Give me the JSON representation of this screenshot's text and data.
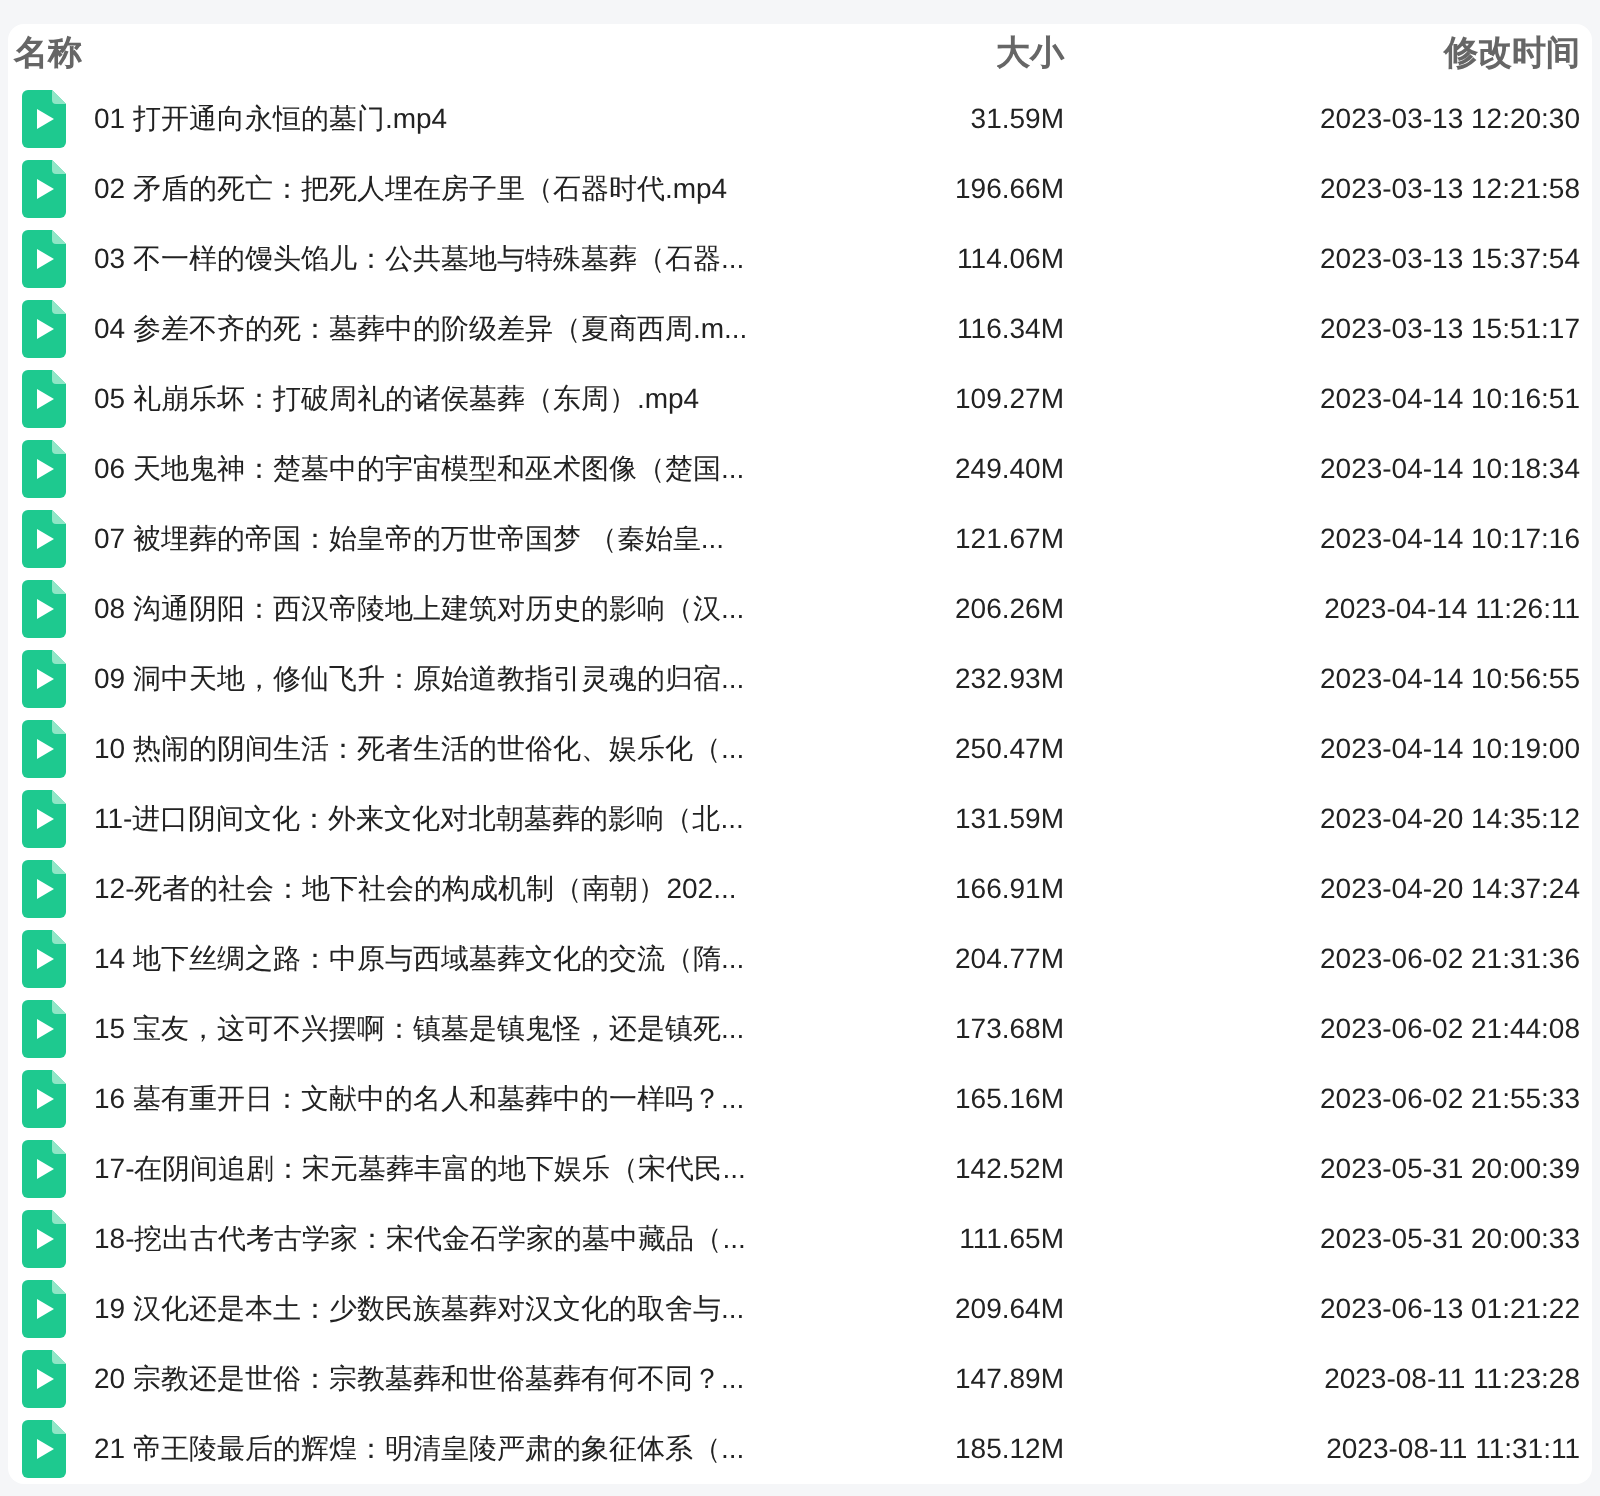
{
  "columns": [
    {
      "label": "名称"
    },
    {
      "label": "大小"
    },
    {
      "label": "修改时间"
    }
  ],
  "files": [
    {
      "name": "01 打开通向永恒的墓门.mp4",
      "size": "31.59M",
      "modified": "2023-03-13 12:20:30"
    },
    {
      "name": "02 矛盾的死亡：把死人埋在房子里（石器时代.mp4",
      "size": "196.66M",
      "modified": "2023-03-13 12:21:58"
    },
    {
      "name": "03 不一样的馒头馅儿：公共墓地与特殊墓葬（石器...",
      "size": "114.06M",
      "modified": "2023-03-13 15:37:54"
    },
    {
      "name": "04 参差不齐的死：墓葬中的阶级差异（夏商西周.m...",
      "size": "116.34M",
      "modified": "2023-03-13 15:51:17"
    },
    {
      "name": "05 礼崩乐坏：打破周礼的诸侯墓葬（东周）.mp4",
      "size": "109.27M",
      "modified": "2023-04-14 10:16:51"
    },
    {
      "name": "06 天地鬼神：楚墓中的宇宙模型和巫术图像（楚国...",
      "size": "249.40M",
      "modified": "2023-04-14 10:18:34"
    },
    {
      "name": "07 被埋葬的帝国：始皇帝的万世帝国梦 （秦始皇...",
      "size": "121.67M",
      "modified": "2023-04-14 10:17:16"
    },
    {
      "name": "08 沟通阴阳：西汉帝陵地上建筑对历史的影响（汉...",
      "size": "206.26M",
      "modified": "2023-04-14 11:26:11"
    },
    {
      "name": "09 洞中天地，修仙飞升：原始道教指引灵魂的归宿...",
      "size": "232.93M",
      "modified": "2023-04-14 10:56:55"
    },
    {
      "name": "10 热闹的阴间生活：死者生活的世俗化、娱乐化（...",
      "size": "250.47M",
      "modified": "2023-04-14 10:19:00"
    },
    {
      "name": "11-进口阴间文化：外来文化对北朝墓葬的影响（北...",
      "size": "131.59M",
      "modified": "2023-04-20 14:35:12"
    },
    {
      "name": "12-死者的社会：地下社会的构成机制（南朝）202...",
      "size": "166.91M",
      "modified": "2023-04-20 14:37:24"
    },
    {
      "name": "14 地下丝绸之路：中原与西域墓葬文化的交流（隋...",
      "size": "204.77M",
      "modified": "2023-06-02 21:31:36"
    },
    {
      "name": "15 宝友，这可不兴摆啊：镇墓是镇鬼怪，还是镇死...",
      "size": "173.68M",
      "modified": "2023-06-02 21:44:08"
    },
    {
      "name": "16 墓有重开日：文献中的名人和墓葬中的一样吗？...",
      "size": "165.16M",
      "modified": "2023-06-02 21:55:33"
    },
    {
      "name": "17-在阴间追剧：宋元墓葬丰富的地下娱乐（宋代民...",
      "size": "142.52M",
      "modified": "2023-05-31 20:00:39"
    },
    {
      "name": "18-挖出古代考古学家：宋代金石学家的墓中藏品（...",
      "size": "111.65M",
      "modified": "2023-05-31 20:00:33"
    },
    {
      "name": "19 汉化还是本土：少数民族墓葬对汉文化的取舍与...",
      "size": "209.64M",
      "modified": "2023-06-13 01:21:22"
    },
    {
      "name": "20 宗教还是世俗：宗教墓葬和世俗墓葬有何不同？...",
      "size": "147.89M",
      "modified": "2023-08-11 11:23:28"
    },
    {
      "name": "21 帝王陵最后的辉煌：明清皇陵严肃的象征体系（...",
      "size": "185.12M",
      "modified": "2023-08-11 11:31:11"
    }
  ]
}
